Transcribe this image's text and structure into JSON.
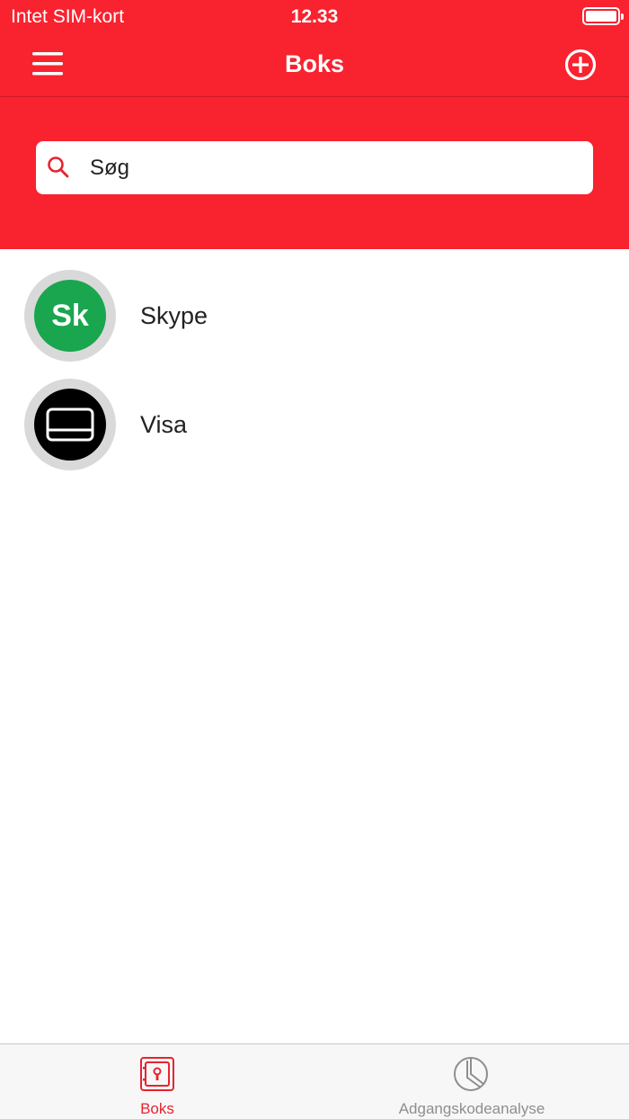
{
  "status_bar": {
    "carrier": "Intet SIM-kort",
    "time": "12.33",
    "battery_icon": "battery-full-icon"
  },
  "nav": {
    "title": "Boks",
    "menu_icon": "hamburger-menu-icon",
    "add_icon": "plus-circle-icon"
  },
  "search": {
    "placeholder": "Søg",
    "value": ""
  },
  "list": {
    "items": [
      {
        "label": "Skype",
        "avatar_text": "Sk",
        "avatar_color": "#19a64f"
      },
      {
        "label": "Visa",
        "avatar_text": "",
        "avatar_icon": "credit-card-icon",
        "avatar_color": "#000000"
      }
    ]
  },
  "tabs": [
    {
      "label": "Boks",
      "icon": "safe-icon",
      "active": true
    },
    {
      "label": "Adgangskodeanalyse",
      "icon": "pie-chart-icon",
      "active": false
    }
  ],
  "colors": {
    "brand_red": "#f9222f",
    "active_tab": "#e8232f",
    "inactive_tab": "#8e8e8e"
  }
}
